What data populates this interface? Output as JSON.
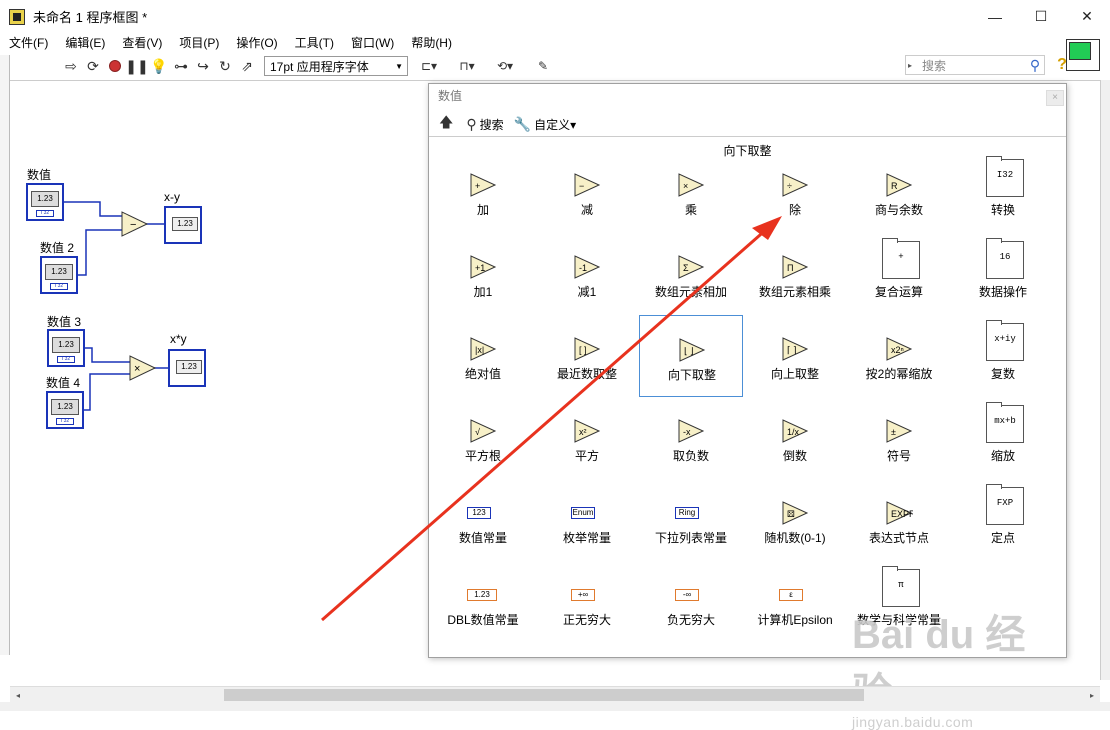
{
  "window": {
    "title": "未命名 1 程序框图 *",
    "controls": {
      "minimize": "—",
      "maximize": "☐",
      "close": "✕"
    }
  },
  "menu": [
    "文件(F)",
    "编辑(E)",
    "查看(V)",
    "项目(P)",
    "操作(O)",
    "工具(T)",
    "窗口(W)",
    "帮助(H)"
  ],
  "toolbar": {
    "font": "17pt 应用程序字体",
    "search_placeholder": "搜索",
    "help": "?"
  },
  "diagram": {
    "labels": {
      "num1": "数值",
      "num2": "数值 2",
      "sub_out": "x-y",
      "num3": "数值 3",
      "num4": "数值 4",
      "mul_out": "x*y"
    },
    "face_value": "1.23",
    "dtype": "I 32",
    "sub_op": "−",
    "mul_op": "×"
  },
  "palette": {
    "title": "数值",
    "close": "×",
    "toolbar": {
      "search": "搜索",
      "customize": "自定义▾"
    },
    "hover_label": "向下取整",
    "items": [
      {
        "label": "加",
        "glyph": "+"
      },
      {
        "label": "减",
        "glyph": "−"
      },
      {
        "label": "乘",
        "glyph": "×"
      },
      {
        "label": "除",
        "glyph": "÷"
      },
      {
        "label": "商与余数",
        "glyph": "R"
      },
      {
        "label": "转换",
        "glyph": "I32"
      },
      {
        "label": "加1",
        "glyph": "+1"
      },
      {
        "label": "减1",
        "glyph": "-1"
      },
      {
        "label": "数组元素相加",
        "glyph": "Σ"
      },
      {
        "label": "数组元素相乘",
        "glyph": "Π"
      },
      {
        "label": "复合运算",
        "glyph": "+"
      },
      {
        "label": "数据操作",
        "glyph": "16"
      },
      {
        "label": "绝对值",
        "glyph": "|x|"
      },
      {
        "label": "最近数取整",
        "glyph": "[ ]"
      },
      {
        "label": "向下取整",
        "glyph": "⌊ ⌋"
      },
      {
        "label": "向上取整",
        "glyph": "⌈ ⌉"
      },
      {
        "label": "按2的幂缩放",
        "glyph": "x2ⁿ"
      },
      {
        "label": "复数",
        "glyph": "x+iy"
      },
      {
        "label": "平方根",
        "glyph": "√"
      },
      {
        "label": "平方",
        "glyph": "x²"
      },
      {
        "label": "取负数",
        "glyph": "-x"
      },
      {
        "label": "倒数",
        "glyph": "1/x"
      },
      {
        "label": "符号",
        "glyph": "±"
      },
      {
        "label": "缩放",
        "glyph": "mx+b"
      },
      {
        "label": "数值常量",
        "glyph": "123"
      },
      {
        "label": "枚举常量",
        "glyph": "Enum"
      },
      {
        "label": "下拉列表常量",
        "glyph": "Ring"
      },
      {
        "label": "随机数(0-1)",
        "glyph": "⚄"
      },
      {
        "label": "表达式节点",
        "glyph": "EXPR"
      },
      {
        "label": "定点",
        "glyph": "FXP"
      },
      {
        "label": "DBL数值常量",
        "glyph": "1.23"
      },
      {
        "label": "正无穷大",
        "glyph": "+∞"
      },
      {
        "label": "负无穷大",
        "glyph": "-∞"
      },
      {
        "label": "计算机Epsilon",
        "glyph": "ε"
      },
      {
        "label": "数学与科学常量",
        "glyph": "π"
      }
    ]
  },
  "watermark": {
    "brand": "Bai du 经验",
    "url": "jingyan.baidu.com"
  },
  "colors": {
    "wire_blue": "#1a34b8",
    "palette_selection": "#4c8fd6",
    "annotation_arrow": "#e8321e",
    "function_yellow": "#f7f0c8",
    "constant_orange": "#e07a2e"
  }
}
